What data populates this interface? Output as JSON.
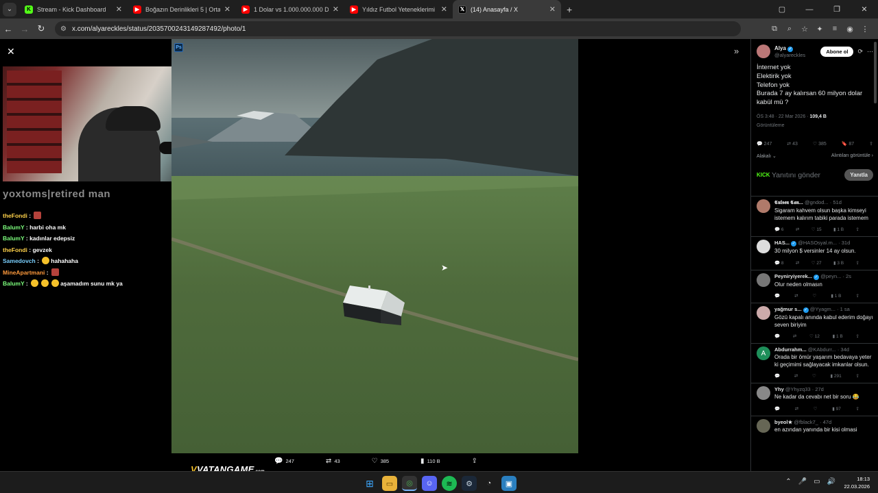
{
  "browser": {
    "tabs": [
      {
        "title": "Stream - Kick Dashboard",
        "icon": "kick-icon",
        "active": false
      },
      {
        "title": "Boğazın Derinlikleri 5 | Ortaköy",
        "icon": "youtube-icon",
        "active": false
      },
      {
        "title": "1 Dolar vs 1.000.000.000 Dolar",
        "icon": "youtube-icon",
        "active": false
      },
      {
        "title": "Yıldız Futbol Yeteneklerimi Puan",
        "icon": "youtube-icon",
        "active": false
      },
      {
        "title": "(14) Anasayfa / X",
        "icon": "x-icon",
        "active": true
      }
    ],
    "url": "x.com/alyareckles/status/2035700243149287492/photo/1"
  },
  "stream": {
    "name": "yoxtoms|retired man",
    "chat": [
      {
        "user": "theFondi",
        "color": "u1",
        "msg": "",
        "emote": "sq"
      },
      {
        "user": "BalumY",
        "color": "u2",
        "msg": "harbi oha mk"
      },
      {
        "user": "BalumY",
        "color": "u2",
        "msg": "kadınlar edepsiz"
      },
      {
        "user": "theFondi",
        "color": "u1",
        "msg": "gevzek"
      },
      {
        "user": "Samedovch",
        "color": "u3",
        "msg": "hahahaha",
        "emote": "round"
      },
      {
        "user": "MineApartmani",
        "color": "u4",
        "msg": "",
        "emote": "sq"
      },
      {
        "user": "BalumY",
        "color": "u2",
        "msg": "aşamadım sunu mk ya",
        "emote": "round3"
      }
    ],
    "sponsor": {
      "pre": "VATAN",
      "post": "GAME",
      "sub": ".com"
    }
  },
  "photo": {
    "badge": "Ps",
    "actions": {
      "replies": "247",
      "reposts": "43",
      "likes": "385",
      "views": "110 B"
    }
  },
  "tweet": {
    "author": "Alya",
    "handle": "@alyareckles",
    "subscribe_label": "Abone ol",
    "lines": [
      "İnternet yok",
      "Elektirik yok",
      "Telefon yok",
      "Burada 7 ay kalırsan 60 milyon dolar kabül mü ?"
    ],
    "time": "ÖS 3:48 · 22 Mar 2026 · ",
    "views": "109,4 B",
    "views_label": "Görüntüleme",
    "stats": {
      "replies": "247",
      "reposts": "43",
      "likes": "385",
      "bookmarks": "87"
    },
    "related_label": "Alakalı",
    "quotes_label": "Alıntıları görüntüle",
    "reply_placeholder": "Yanıtını gönder",
    "reply_button": "Yanıtla",
    "kick_badge": "KICK"
  },
  "replies": [
    {
      "name": "𝕮𝖚𝖑𝖘𝖊𝖓 𝕮𝖆𝖓...",
      "handle": "@gndod... · 51d",
      "text": "Sigaram kahvem olsun başka kimseyi istemem kalırım tabiki parada istemem",
      "r": "6",
      "rt": "",
      "l": "15",
      "v": "1 B",
      "avatar": "#b07a6a"
    },
    {
      "name": "HAS...",
      "handle": "@HASOsyal.m... · 31d",
      "text": "30 milyon $ versinler 14 ay olsun.",
      "r": "8",
      "rt": "",
      "l": "27",
      "v": "3 B",
      "avatar": "#ddd"
    },
    {
      "name": "Peyniryiyerek...",
      "handle": "@peyn... · 2s",
      "text": "Olur neden olmasın",
      "r": "",
      "rt": "",
      "l": "",
      "v": "1 B",
      "avatar": "#777"
    },
    {
      "name": "yağmur s...",
      "handle": "@Yyagm... · 1 sa",
      "text": "Gözü kapalı anında kabul ederim doğayı seven biriyim",
      "r": "",
      "rt": "",
      "l": "12",
      "v": "1 B",
      "avatar": "#caa"
    },
    {
      "name": "Abdurrahm...",
      "handle": "@KAbdurr... · 34d",
      "text": "Orada bir ömür yaşarım bedavaya yeter ki geçimimi sağlayacak imkanlar olsun.",
      "r": "",
      "rt": "",
      "l": "",
      "v": "291",
      "avatar": "#1e8f5a",
      "letter": "A"
    },
    {
      "name": "Yhy",
      "handle": "@Yhyzq33 · 27d",
      "text": "Ne kadar da cevabı net bir soru 😂",
      "r": "",
      "rt": "",
      "l": "",
      "v": "97",
      "avatar": "#888"
    },
    {
      "name": "byeol★",
      "handle": "@fblack7_ · 47d",
      "text": "en azından yanında bir kisi olmasi",
      "r": "",
      "rt": "",
      "l": "",
      "v": "",
      "avatar": "#665"
    }
  ],
  "system": {
    "time": "18:13",
    "date": "22.03.2026"
  }
}
